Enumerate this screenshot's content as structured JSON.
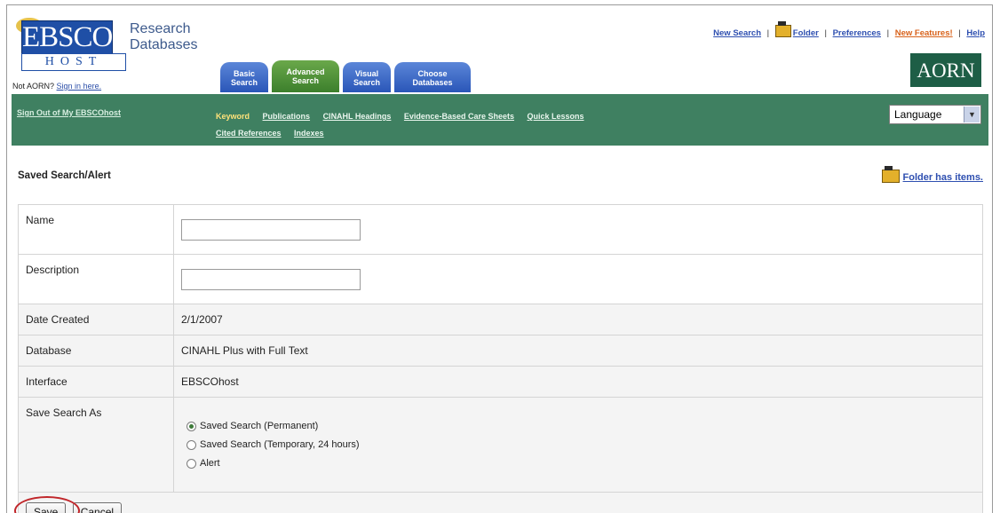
{
  "brand": {
    "logo_main": "EBSCO",
    "logo_sub": "HOST",
    "title_line1": "Research",
    "title_line2": "Databases"
  },
  "login": {
    "prompt": "Not AORN?",
    "link": "Sign in here."
  },
  "toplinks": {
    "new_search": "New Search",
    "folder": "Folder",
    "preferences": "Preferences",
    "new_features": "New Features!",
    "help": "Help",
    "separator": "|"
  },
  "aorn_badge": "AORN",
  "tabs": [
    {
      "line1": "Basic",
      "line2": "Search"
    },
    {
      "line1": "Advanced",
      "line2": "Search"
    },
    {
      "line1": "Visual",
      "line2": "Search"
    },
    {
      "line1": "Choose",
      "line2": "Databases"
    }
  ],
  "nav": {
    "signout": "Sign Out of My EBSCOhost",
    "links": [
      "Keyword",
      "Publications",
      "CINAHL Headings",
      "Evidence-Based Care Sheets",
      "Quick Lessons",
      "Cited References",
      "Indexes"
    ],
    "language": "Language"
  },
  "page": {
    "title": "Saved Search/Alert",
    "folder_status": "Folder has items."
  },
  "form": {
    "name_label": "Name",
    "name_value": "",
    "description_label": "Description",
    "description_value": "",
    "date_label": "Date Created",
    "date_value": "2/1/2007",
    "database_label": "Database",
    "database_value": "CINAHL Plus with Full Text",
    "interface_label": "Interface",
    "interface_value": "EBSCOhost",
    "save_as_label": "Save Search As",
    "options": [
      "Saved Search (Permanent)",
      "Saved Search (Temporary, 24 hours)",
      "Alert"
    ],
    "selected_option": "Saved Search (Permanent)",
    "save_button": "Save",
    "cancel_button": "Cancel"
  },
  "colors": {
    "nav_green": "#3f8061",
    "tab_blue": "#2a56b8",
    "tab_green": "#3c7f2c",
    "link_blue": "#2e4fb0",
    "highlight_red": "#c0262a"
  }
}
